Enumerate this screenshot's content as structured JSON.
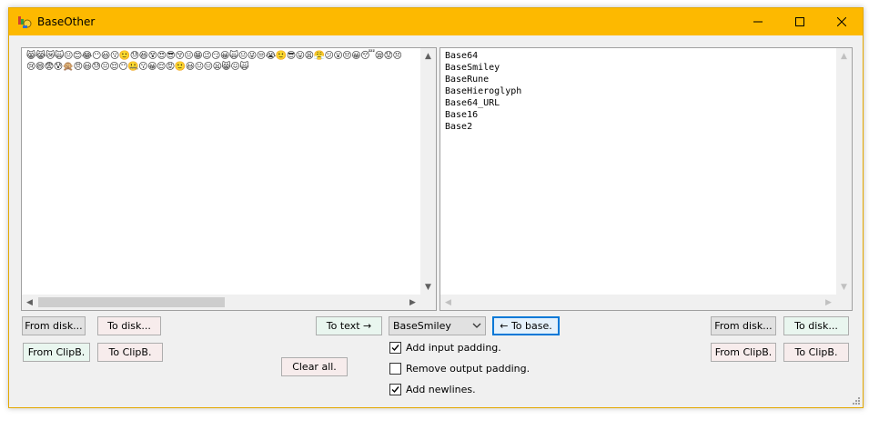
{
  "window": {
    "title": "BaseOther",
    "minimize_label": "minimize",
    "maximize_label": "maximize",
    "close_label": "close"
  },
  "left_pane": {
    "content": "😸😹😿🙀😐😊😂😶😃😗🙂😓😆😵😍😎😚😐😁😉😏😀🙀😐😜😒😭🙂😎😛😩😤😕😮😔😀😴😪😟😣😢😄😨😰🙊😠😃😓😐😌😶🤐😗😀😌😡🙂😃😐😑😦😸😖🙀"
  },
  "right_pane": {
    "items": [
      "Base64",
      "BaseSmiley",
      "BaseRune",
      "BaseHieroglyph",
      "Base64_URL",
      "Base16",
      "Base2"
    ]
  },
  "left_controls": {
    "from_disk": "From disk...",
    "to_disk": "To disk...",
    "from_clip": "From ClipB.",
    "to_clip": "To ClipB."
  },
  "center_controls": {
    "to_text": "To text →",
    "clear_all": "Clear all.",
    "encoding_selected": "BaseSmiley",
    "to_base": "← To base.",
    "add_input_padding": {
      "label": "Add input padding.",
      "checked": true
    },
    "remove_output_padding": {
      "label": "Remove output padding.",
      "checked": false
    },
    "add_newlines": {
      "label": "Add newlines.",
      "checked": true
    }
  },
  "right_controls": {
    "from_disk": "From disk...",
    "to_disk": "To disk...",
    "from_clip": "From ClipB.",
    "to_clip": "To ClipB."
  },
  "colors": {
    "titlebar": "#fdb900",
    "window_bg": "#f0f0f0",
    "focus_border": "#0078d7"
  }
}
